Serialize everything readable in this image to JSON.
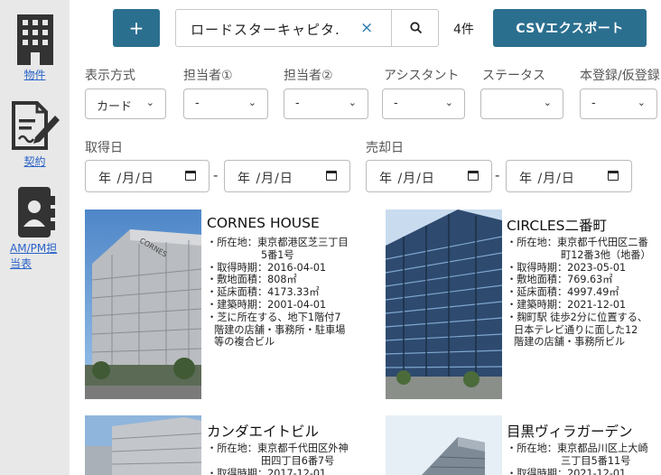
{
  "sidebar": {
    "items": [
      {
        "label": "物件",
        "icon": "building-icon"
      },
      {
        "label": "契約",
        "icon": "contract-icon"
      },
      {
        "label": "AM/PM担当表",
        "label_line1": "AM/PM担",
        "label_line2": "当表",
        "icon": "contact-book-icon"
      }
    ]
  },
  "toolbar": {
    "add_label": "+",
    "search_value": "ロードスターキャピタ.",
    "clear_glyph": "×",
    "count": "4件",
    "csv_label": "CSVエクスポート"
  },
  "filters": {
    "labels": [
      "表示方式",
      "担当者①",
      "担当者②",
      "アシスタント",
      "ステータス",
      "本登録/仮登録"
    ],
    "values": [
      "カード",
      "-",
      "-",
      "-",
      "",
      "-"
    ]
  },
  "dates": {
    "acquired_label": "取得日",
    "sold_label": "売却日",
    "placeholder": "年 /月/日",
    "separator": "-"
  },
  "cards": [
    {
      "title": "CORNES HOUSE",
      "lines": [
        {
          "t": "・所在地：東京都港区芝三丁目",
          "c": ""
        },
        {
          "t": "5番1号",
          "c": "indent"
        },
        {
          "t": "・取得時期：2016-04-01",
          "c": ""
        },
        {
          "t": "・敷地面積：808㎡",
          "c": ""
        },
        {
          "t": "・延床面積：4173.33㎡",
          "c": ""
        },
        {
          "t": "・建築時期：2001-04-01",
          "c": ""
        },
        {
          "t": "・芝に所在する、地下1階付7",
          "c": ""
        },
        {
          "t": "階建の店舗・事務所・駐車場",
          "c": "desc"
        },
        {
          "t": "等の複合ビル",
          "c": "desc"
        }
      ]
    },
    {
      "title": "CIRCLES二番町",
      "lines": [
        {
          "t": "・所在地：東京都千代田区二番",
          "c": ""
        },
        {
          "t": "町12番3他（地番）",
          "c": "indent"
        },
        {
          "t": "・取得時期：2023-05-01",
          "c": ""
        },
        {
          "t": "・敷地面積：769.63㎡",
          "c": ""
        },
        {
          "t": "・延床面積：4997.49㎡",
          "c": ""
        },
        {
          "t": "・建築時期：2021-12-01",
          "c": ""
        },
        {
          "t": "・麹町駅 徒歩2分に位置する、",
          "c": ""
        },
        {
          "t": "日本テレビ通りに面した12",
          "c": "desc"
        },
        {
          "t": "階建の店舗・事務所ビル",
          "c": "desc"
        }
      ]
    },
    {
      "title": "カンダエイトビル",
      "lines": [
        {
          "t": "・所在地：東京都千代田区外神",
          "c": ""
        },
        {
          "t": "田四丁目6番7号",
          "c": "indent"
        },
        {
          "t": "・取得時期：2017-12-01",
          "c": ""
        }
      ]
    },
    {
      "title": "目黒ヴィラガーデン",
      "lines": [
        {
          "t": "・所在地：東京都品川区上大崎",
          "c": ""
        },
        {
          "t": "三丁目5番11号",
          "c": "indent"
        },
        {
          "t": "・取得時期：2021-12-01",
          "c": ""
        }
      ]
    }
  ],
  "colors": {
    "primary": "#2b6f8f",
    "sidebar_bg": "#e8e8e8",
    "link": "#2a63c9"
  }
}
